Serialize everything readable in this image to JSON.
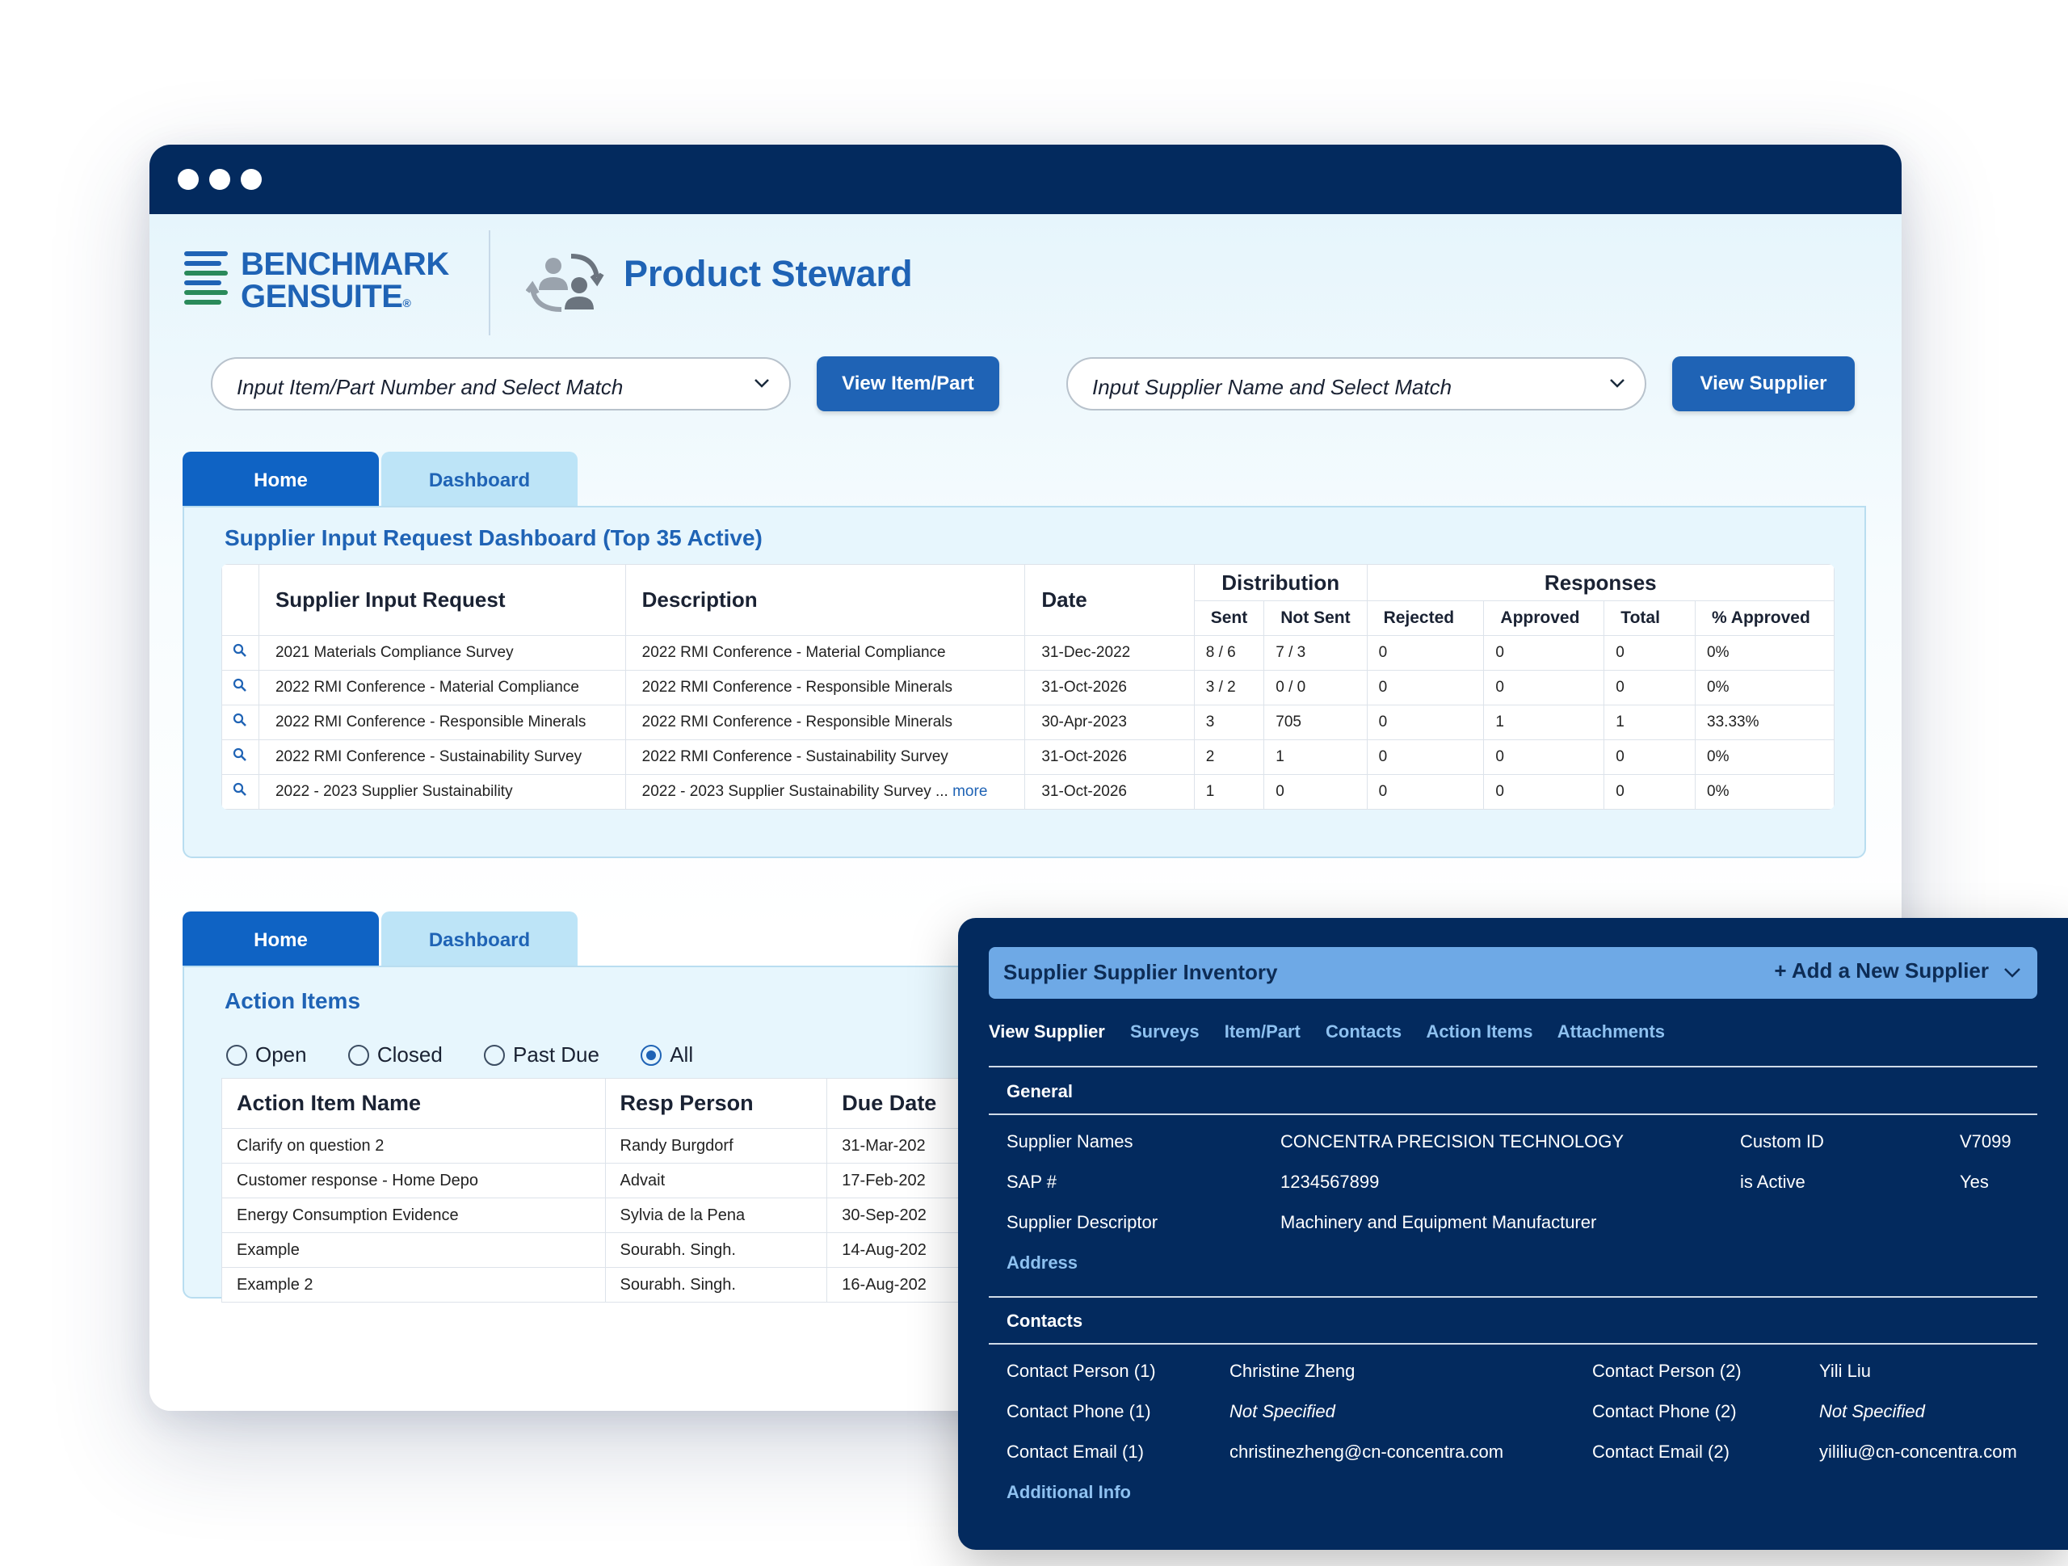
{
  "brand": {
    "logo_line1": "BENCHMARK",
    "logo_line2": "GENSUITE",
    "logo_mark": "®",
    "app_title": "Product Steward",
    "app_icon": "people-sync-icon"
  },
  "search": {
    "item_placeholder": "Input Item/Part Number and Select Match",
    "item_button": "View Item/Part",
    "supplier_placeholder": "Input Supplier Name and Select Match",
    "supplier_button": "View Supplier"
  },
  "colors": {
    "titlebar": "#032a5e",
    "primary": "#1f63b5",
    "tab_active": "#0f63c4",
    "tab_inactive": "#bde4f7",
    "panel_bg": "#e7f6fd",
    "overlay_bg": "#032a5e",
    "overlay_header": "#6ea9e6"
  },
  "tabs_top": [
    {
      "label": "Home"
    },
    {
      "label": "Dashboard"
    }
  ],
  "sir_panel": {
    "title": "Supplier Input Request Dashboard (Top 35 Active)",
    "headers": {
      "request": "Supplier Input Request",
      "description": "Description",
      "date": "Date",
      "distribution": "Distribution",
      "responses": "Responses",
      "sent": "Sent",
      "not_sent": "Not Sent",
      "rejected": "Rejected",
      "approved": "Approved",
      "total": "Total",
      "pct_approved": "% Approved"
    },
    "more_label": "more",
    "rows": [
      {
        "request": "2021 Materials Compliance Survey",
        "description": "2022 RMI Conference - Material Compliance",
        "date": "31-Dec-2022",
        "sent": "8 / 6",
        "not_sent": "7 / 3",
        "rejected": "0",
        "approved": "0",
        "total": "0",
        "pct": "0%"
      },
      {
        "request": "2022 RMI Conference - Material Compliance",
        "description": "2022 RMI Conference - Responsible Minerals",
        "date": "31-Oct-2026",
        "sent": "3 / 2",
        "not_sent": "0 / 0",
        "rejected": "0",
        "approved": "0",
        "total": "0",
        "pct": "0%"
      },
      {
        "request": "2022 RMI Conference - Responsible Minerals",
        "description": "2022 RMI Conference - Responsible Minerals",
        "date": "30-Apr-2023",
        "sent": "3",
        "not_sent": "705",
        "rejected": "0",
        "approved": "1",
        "total": "1",
        "pct": "33.33%"
      },
      {
        "request": "2022 RMI Conference - Sustainability Survey",
        "description": "2022 RMI Conference - Sustainability Survey",
        "date": "31-Oct-2026",
        "sent": "2",
        "not_sent": "1",
        "rejected": "0",
        "approved": "0",
        "total": "0",
        "pct": "0%"
      },
      {
        "request": "2022 - 2023 Supplier Sustainability",
        "description": "2022 - 2023 Supplier Sustainability Survey ...",
        "date": "31-Oct-2026",
        "sent": "1",
        "not_sent": "0",
        "rejected": "0",
        "approved": "0",
        "total": "0",
        "pct": "0%"
      }
    ]
  },
  "tabs_bottom": [
    {
      "label": "Home"
    },
    {
      "label": "Dashboard"
    }
  ],
  "action_items": {
    "title": "Action Items",
    "filters": [
      {
        "label": "Open",
        "selected": false
      },
      {
        "label": "Closed",
        "selected": false
      },
      {
        "label": "Past Due",
        "selected": false
      },
      {
        "label": "All",
        "selected": true
      }
    ],
    "headers": {
      "name": "Action Item Name",
      "person": "Resp Person",
      "due": "Due Date"
    },
    "rows": [
      {
        "name": "Clarify on question 2",
        "person": "Randy Burgdorf",
        "due": "31-Mar-202"
      },
      {
        "name": "Customer response - Home Depo",
        "person": "Advait",
        "due": "17-Feb-202"
      },
      {
        "name": "Energy Consumption Evidence",
        "person": "Sylvia de la Pena",
        "due": "30-Sep-202"
      },
      {
        "name": "Example",
        "person": "Sourabh. Singh.",
        "due": "14-Aug-202"
      },
      {
        "name": "Example 2",
        "person": "Sourabh. Singh.",
        "due": "16-Aug-202"
      }
    ]
  },
  "supplier_panel": {
    "title": "Supplier Supplier Inventory",
    "add_label": "+ Add a New Supplier",
    "tabs": [
      "View Supplier",
      "Surveys",
      "Item/Part",
      "Contacts",
      "Action Items",
      "Attachments"
    ],
    "general_title": "General",
    "general": {
      "names_label": "Supplier Names",
      "names_value": "CONCENTRA PRECISION TECHNOLOGY",
      "custom_id_label": "Custom ID",
      "custom_id_value": "V7099",
      "sap_label": "SAP #",
      "sap_value": "1234567899",
      "active_label": "is Active",
      "active_value": "Yes",
      "descriptor_label": "Supplier Descriptor",
      "descriptor_value": "Machinery and Equipment Manufacturer"
    },
    "address_link": "Address",
    "contacts_title": "Contacts",
    "contacts": {
      "p1_label": "Contact Person (1)",
      "p1_value": "Christine Zheng",
      "p2_label": "Contact Person (2)",
      "p2_value": "Yili Liu",
      "ph1_label": "Contact Phone (1)",
      "ph1_value": "Not Specified",
      "ph2_label": "Contact Phone (2)",
      "ph2_value": "Not Specified",
      "e1_label": "Contact Email (1)",
      "e1_value": "christinezheng@cn-concentra.com",
      "e2_label": "Contact Email (2)",
      "e2_value": "yililiu@cn-concentra.com"
    },
    "additional_link": "Additional Info"
  }
}
